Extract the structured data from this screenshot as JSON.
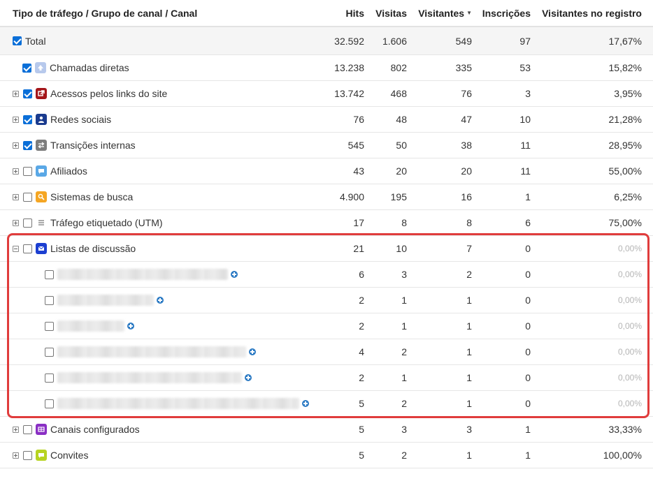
{
  "header": {
    "name": "Tipo de tráfego / Grupo de canal / Canal",
    "hits": "Hits",
    "visits": "Visitas",
    "visitors": "Visitantes",
    "signups": "Inscrições",
    "registered": "Visitantes no registro"
  },
  "colors": {
    "accent": "#0b6fd8",
    "highlight": "#e03c3c"
  },
  "rows": [
    {
      "label": "Total",
      "hits": "32.592",
      "visits": "1.606",
      "visitors": "549",
      "signups": "97",
      "registered": "17,67%"
    },
    {
      "label": "Chamadas diretas",
      "hits": "13.238",
      "visits": "802",
      "visitors": "335",
      "signups": "53",
      "registered": "15,82%",
      "icon": "direct-arrow-icon"
    },
    {
      "label": "Acessos pelos links do site",
      "hits": "13.742",
      "visits": "468",
      "visitors": "76",
      "signups": "3",
      "registered": "3,95%",
      "icon": "external-link-icon"
    },
    {
      "label": "Redes sociais",
      "hits": "76",
      "visits": "48",
      "visitors": "47",
      "signups": "10",
      "registered": "21,28%",
      "icon": "person-icon"
    },
    {
      "label": "Transições internas",
      "hits": "545",
      "visits": "50",
      "visitors": "38",
      "signups": "11",
      "registered": "28,95%",
      "icon": "swap-arrows-icon"
    },
    {
      "label": "Afiliados",
      "hits": "43",
      "visits": "20",
      "visitors": "20",
      "signups": "11",
      "registered": "55,00%",
      "icon": "chat-bubble-icon"
    },
    {
      "label": "Sistemas de busca",
      "hits": "4.900",
      "visits": "195",
      "visitors": "16",
      "signups": "1",
      "registered": "6,25%",
      "icon": "search-icon"
    },
    {
      "label": "Tráfego etiquetado (UTM)",
      "hits": "17",
      "visits": "8",
      "visitors": "8",
      "signups": "6",
      "registered": "75,00%",
      "icon": "list-icon"
    },
    {
      "label": "Listas de discussão",
      "hits": "21",
      "visits": "10",
      "visitors": "7",
      "signups": "0",
      "registered": "0,00%",
      "icon": "envelope-icon"
    },
    {
      "label": "",
      "hits": "6",
      "visits": "3",
      "visitors": "2",
      "signups": "0",
      "registered": "0,00%"
    },
    {
      "label": "",
      "hits": "2",
      "visits": "1",
      "visitors": "1",
      "signups": "0",
      "registered": "0,00%"
    },
    {
      "label": "",
      "hits": "2",
      "visits": "1",
      "visitors": "1",
      "signups": "0",
      "registered": "0,00%"
    },
    {
      "label": "",
      "hits": "4",
      "visits": "2",
      "visitors": "1",
      "signups": "0",
      "registered": "0,00%"
    },
    {
      "label": "",
      "hits": "2",
      "visits": "1",
      "visitors": "1",
      "signups": "0",
      "registered": "0,00%"
    },
    {
      "label": "",
      "hits": "5",
      "visits": "2",
      "visitors": "1",
      "signups": "0",
      "registered": "0,00%"
    },
    {
      "label": "Canais configurados",
      "hits": "5",
      "visits": "3",
      "visitors": "3",
      "signups": "1",
      "registered": "33,33%",
      "icon": "grid-icon"
    },
    {
      "label": "Convites",
      "hits": "5",
      "visits": "2",
      "visitors": "1",
      "signups": "1",
      "registered": "100,00%",
      "icon": "speech-icon"
    }
  ]
}
